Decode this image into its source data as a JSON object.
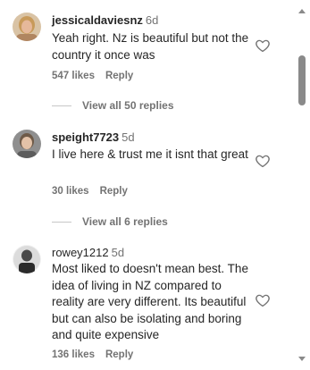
{
  "comments": [
    {
      "username": "jessicaldaviesnz",
      "time": "6d",
      "text": "Yeah right. Nz is beautiful but not the country it once was",
      "likes": "547 likes",
      "reply": "Reply",
      "view_replies": "View all 50 replies",
      "avatar_colors": {
        "bg": "#d9c3a5",
        "face": "#e6b89a",
        "hair": "#c89a5a"
      }
    },
    {
      "username": "speight7723",
      "time": "5d",
      "text": "I live here & trust me it isnt that great",
      "likes": "30 likes",
      "reply": "Reply",
      "view_replies": "View all 6 replies",
      "avatar_colors": {
        "bg": "#8f8f8f",
        "face": "#e3c2a8",
        "hair": "#6e5a48"
      }
    },
    {
      "username": "rowey1212",
      "time": "5d",
      "text": "Most liked to doesn't mean best. The idea of living in NZ compared to reality are very different. Its beautiful but can also be isolating and boring and quite expensive",
      "likes": "136 likes",
      "reply": "Reply",
      "avatar_colors": {
        "bg": "#f2f2f2",
        "face": "#4a4a4a",
        "hair": "#2b2b2b"
      }
    }
  ],
  "icons": {
    "like": "heart-outline-icon",
    "scroll_up": "scroll-up-arrow",
    "scroll_down": "scroll-down-arrow"
  }
}
